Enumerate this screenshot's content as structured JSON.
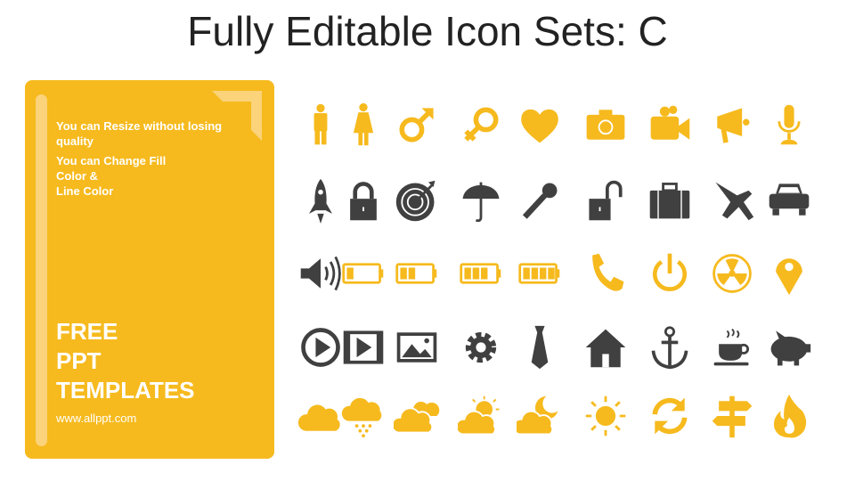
{
  "title": "Fully Editable Icon Sets: C",
  "card": {
    "line1": "You can Resize without losing quality",
    "line2a": "You can Change Fill",
    "line2b": "Color &",
    "line2c": "Line Color",
    "big1": "FREE",
    "big2": "PPT",
    "big3": "TEMPLATES",
    "url": "www.allppt.com"
  },
  "colors": {
    "accent": "#F6BA1E",
    "dark": "#404040",
    "bar": "#FAD37A"
  },
  "icons": [
    [
      "male",
      "female",
      "male-symbol",
      "female-symbol",
      "heart",
      "camera",
      "video-camera",
      "megaphone",
      "microphone"
    ],
    [
      "rocket",
      "lock",
      "target",
      "umbrella",
      "key",
      "unlock",
      "briefcase",
      "airplane",
      "car"
    ],
    [
      "speaker",
      "battery-1",
      "battery-2",
      "battery-3",
      "battery-4",
      "phone",
      "power",
      "radiation",
      "location-pin"
    ],
    [
      "play",
      "film",
      "image",
      "gear",
      "tie",
      "house",
      "anchor",
      "coffee",
      "piggy-bank"
    ],
    [
      "cloud",
      "rain-cloud",
      "clouds",
      "sun-cloud",
      "moon-cloud",
      "sun",
      "refresh",
      "signpost",
      "fire"
    ]
  ],
  "row_colors": [
    "accent",
    "dark",
    "mixed",
    "dark",
    "accent"
  ]
}
